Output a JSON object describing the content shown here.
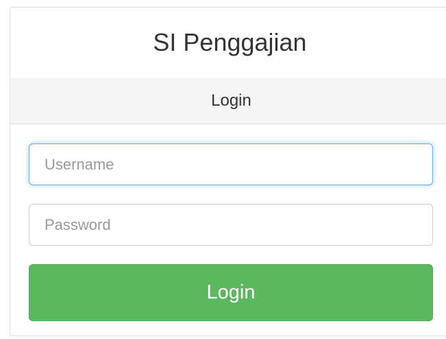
{
  "panel": {
    "title": "SI Penggajian",
    "subtitle": "Login"
  },
  "form": {
    "username_placeholder": "Username",
    "username_value": "",
    "password_placeholder": "Password",
    "password_value": "",
    "submit_label": "Login"
  },
  "colors": {
    "primary_button": "#5cb85c",
    "focus_border": "#66afe9",
    "subheader_bg": "#f5f5f5"
  }
}
